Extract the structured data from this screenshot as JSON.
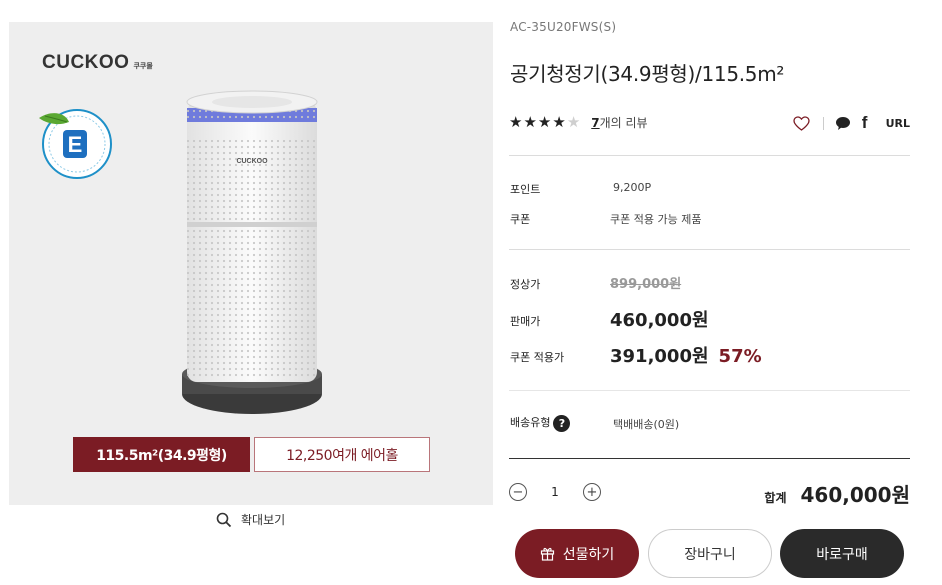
{
  "product_image": {
    "brand": "CUCKOO",
    "brand_sub": "쿠쿠몰",
    "device_logo": "CUCKOO",
    "badge_text": "E-순환 우수제품 · E-CYCLE EXCELLENT PRODUCT",
    "tags": {
      "area": "115.5m²(34.9평형)",
      "air_holes": "12,250여개 에어홀"
    }
  },
  "zoom_label": "확대보기",
  "product": {
    "model": "AC-35U20FWS(S)",
    "title": "공기청정기(34.9평형)/115.5m²",
    "rating_stars": 4,
    "rating_max": 5,
    "review_count": "7",
    "review_suffix": "개의 리뷰",
    "share_url_label": "URL"
  },
  "info": {
    "point_label": "포인트",
    "point_value": "9,200P",
    "coupon_label": "쿠폰",
    "coupon_value": "쿠폰 적용 가능 제품"
  },
  "price": {
    "regular_label": "정상가",
    "regular_value": "899,000원",
    "sale_label": "판매가",
    "sale_value": "460,000원",
    "coupon_label": "쿠폰 적용가",
    "coupon_value": "391,000원",
    "discount": "57%"
  },
  "delivery": {
    "label": "배송유형",
    "help": "?",
    "value": "택배배송(0원)"
  },
  "order": {
    "quantity": "1",
    "minus": "−",
    "plus": "+",
    "total_label": "합계",
    "total_value": "460,000원"
  },
  "buttons": {
    "gift": "선물하기",
    "cart": "장바구니",
    "buy": "바로구매"
  },
  "colors": {
    "accent": "#7b1c24",
    "dark": "#2a2a2a",
    "panel_bg": "#eeeeee"
  }
}
